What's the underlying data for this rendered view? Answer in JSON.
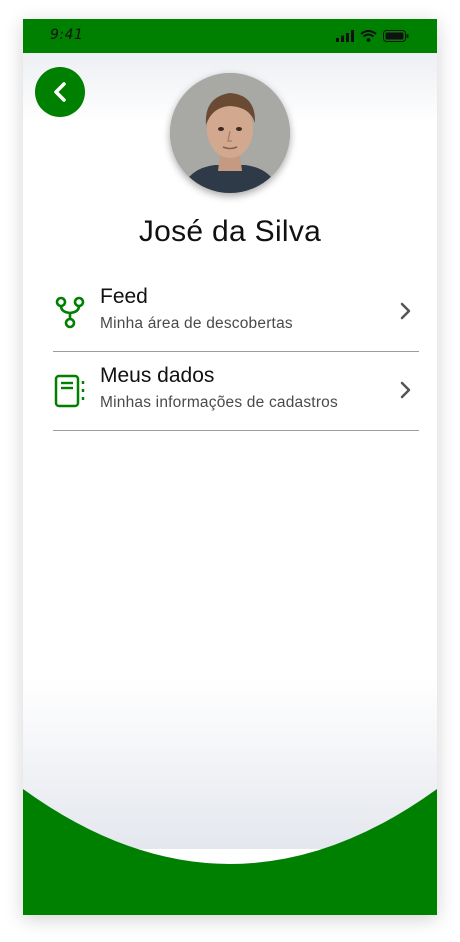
{
  "status_bar": {
    "time": "9:41"
  },
  "header": {
    "back_icon": "chevron-left-icon"
  },
  "profile": {
    "name": "José da Silva"
  },
  "menu": [
    {
      "title": "Feed",
      "subtitle": "Minha área de descobertas",
      "icon": "fork-icon"
    },
    {
      "title": "Meus dados",
      "subtitle": "Minhas informações de cadastros",
      "icon": "notebook-icon"
    }
  ],
  "colors": {
    "accent": "#008000",
    "text": "#111111",
    "subtext": "#4a4a4a",
    "divider": "#9c9c9c"
  }
}
